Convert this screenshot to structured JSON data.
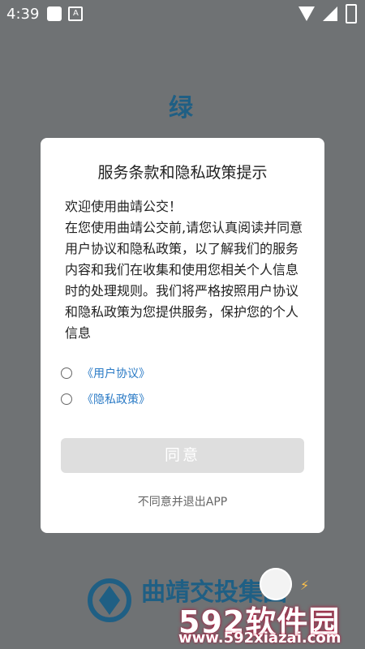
{
  "status_bar": {
    "time": "4:39",
    "icons": [
      "app-square-icon",
      "a-notification-icon",
      "wifi-icon",
      "cell-signal-icon",
      "battery-icon"
    ]
  },
  "brand": {
    "top_char": "绿",
    "footer_title": "曲靖交投集团"
  },
  "modal": {
    "title": "服务条款和隐私政策提示",
    "body": "欢迎使用曲靖公交！\n在您使用曲靖公交前,请您认真阅读并同意用户协议和隐私政策，以了解我们的服务内容和我们在收集和使用您相关个人信息时的处理规则。我们将严格按照用户协议和隐私政策为您提供服务，保护您的个人信息",
    "agreements": [
      {
        "label": "《用户协议》"
      },
      {
        "label": "《隐私政策》"
      }
    ],
    "agree_button": "同意",
    "disagree_link": "不同意并退出APP"
  },
  "watermark": {
    "main": "592软件园",
    "url": "www.592xiazai.com"
  },
  "colors": {
    "overlay": "#6f7274",
    "brand_blue": "#1f5f84",
    "link_blue": "#2b7bc6",
    "button_disabled": "#dedede"
  }
}
